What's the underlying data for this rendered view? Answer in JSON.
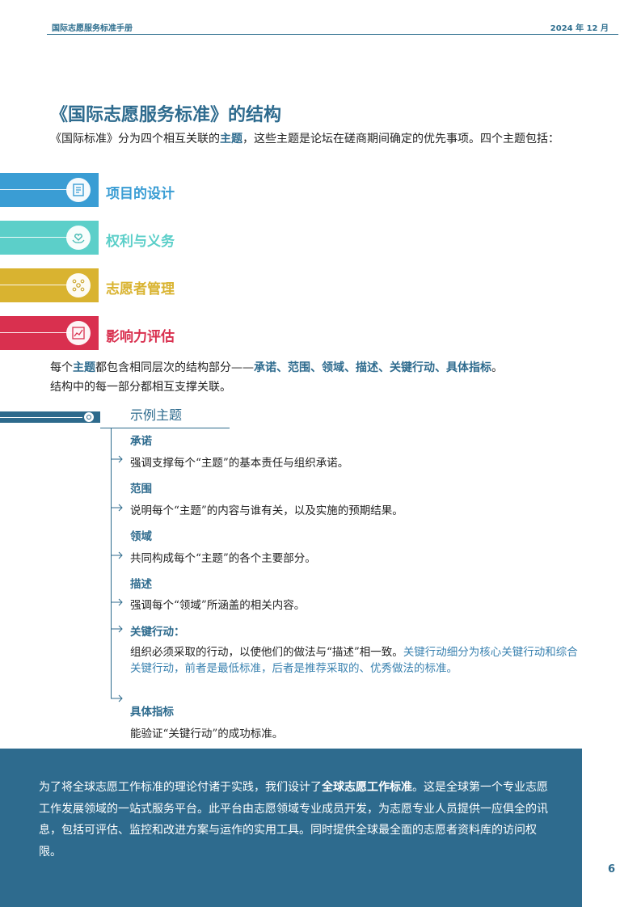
{
  "header": {
    "left": "国际志愿服务标准手册",
    "right": "2024 年 12 月"
  },
  "title": "《国际志愿服务标准》的结构",
  "intro": {
    "before": "《国际标准》分为四个相互关联的",
    "highlight": "主题",
    "after": "，这些主题是论坛在磋商期间确定的优先事项。四个主题包括："
  },
  "themes": [
    {
      "label": "项目的设计",
      "color": "#3a9dd4",
      "icon": "design-icon"
    },
    {
      "label": "权利与义务",
      "color": "#5ccfc9",
      "icon": "hands-heart-icon"
    },
    {
      "label": "志愿者管理",
      "color": "#d9b330",
      "icon": "people-network-icon"
    },
    {
      "label": "影响力评估",
      "color": "#d9304f",
      "icon": "chart-assessment-icon"
    }
  ],
  "structure": {
    "prefix": "每个",
    "highlight1": "主题",
    "middle": "都包含相同层次的结构部分——",
    "highlight2": "承诺、范围、领域、描述、关键行动、具体指标",
    "end": "。",
    "line2": "结构中的每一部分都相互支撑关联。"
  },
  "example": {
    "title": "示例主题",
    "sections": [
      {
        "heading": "承诺",
        "text": "强调支撑每个“主题”的基本责任与组织承诺。"
      },
      {
        "heading": "范围",
        "text": "说明每个“主题”的内容与谁有关，以及实施的预期结果。"
      },
      {
        "heading": "领域",
        "text": "共同构成每个“主题”的各个主要部分。"
      },
      {
        "heading": "描述",
        "text": "强调每个“领域”所涵盖的相关内容。"
      },
      {
        "heading": "关键行动：",
        "text": "组织必须采取的行动，以使他们的做法与“描述”相一致。",
        "note": "关键行动细分为核心关键行动和综合关键行动，前者是最低标准，后者是推荐采取的、优秀做法的标准。"
      },
      {
        "heading": "具体指标",
        "text": "能验证“关键行动”的成功标准。"
      }
    ]
  },
  "footer": {
    "before": "为了将全球志愿工作标准的理论付诸于实践，我们设计了",
    "bold": "全球志愿工作标准",
    "after": "。这是全球第一个专业志愿工作发展领域的一站式服务平台。此平台由志愿领域专业成员开发，为志愿专业人员提供一应俱全的讯息，包括可评估、监控和改进方案与运作的实用工具。同时提供全球最全面的志愿者资料库的访问权限。"
  },
  "page_number": "6"
}
